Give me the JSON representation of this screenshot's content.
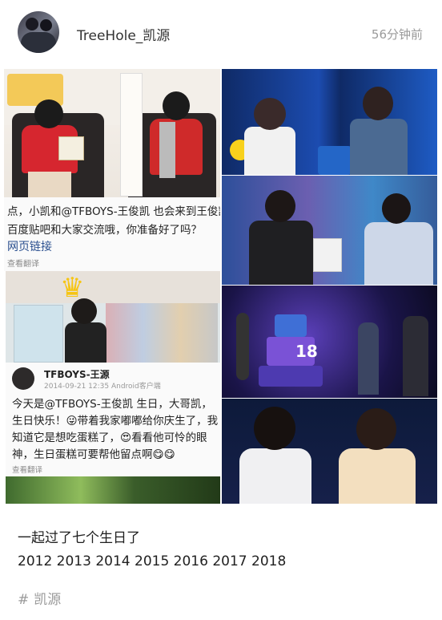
{
  "post": {
    "username": "TreeHole_凯源",
    "time": "56分钟前",
    "caption": "一起过了七个生日了",
    "years": "2012 2013 2014 2015 2016 2017 2018",
    "hashtag_symbol": "#",
    "hashtag": "凯源"
  },
  "embedded_post1": {
    "line1": "点，小凯和@TFBOYS-王俊凯 也会来到王俊凯",
    "line2": "百度贴吧和大家交流哦，你准备好了吗？",
    "link": "网页链接",
    "translate": "查看翻译"
  },
  "embedded_post2": {
    "name": "TFBOYS-王源",
    "meta": "2014-09-21 12:35  Android客户端",
    "text": "今天是@TFBOYS-王俊凯 生日，大哥凯，生日快乐！😜带着我家嘟嘟给你庆生了，我知道它是想吃蛋糕了，😍看看他可怜的眼神，生日蛋糕可要帮他留点啊😋😋",
    "translate": "查看翻译"
  },
  "photo_text": {
    "cake_number": "18"
  }
}
